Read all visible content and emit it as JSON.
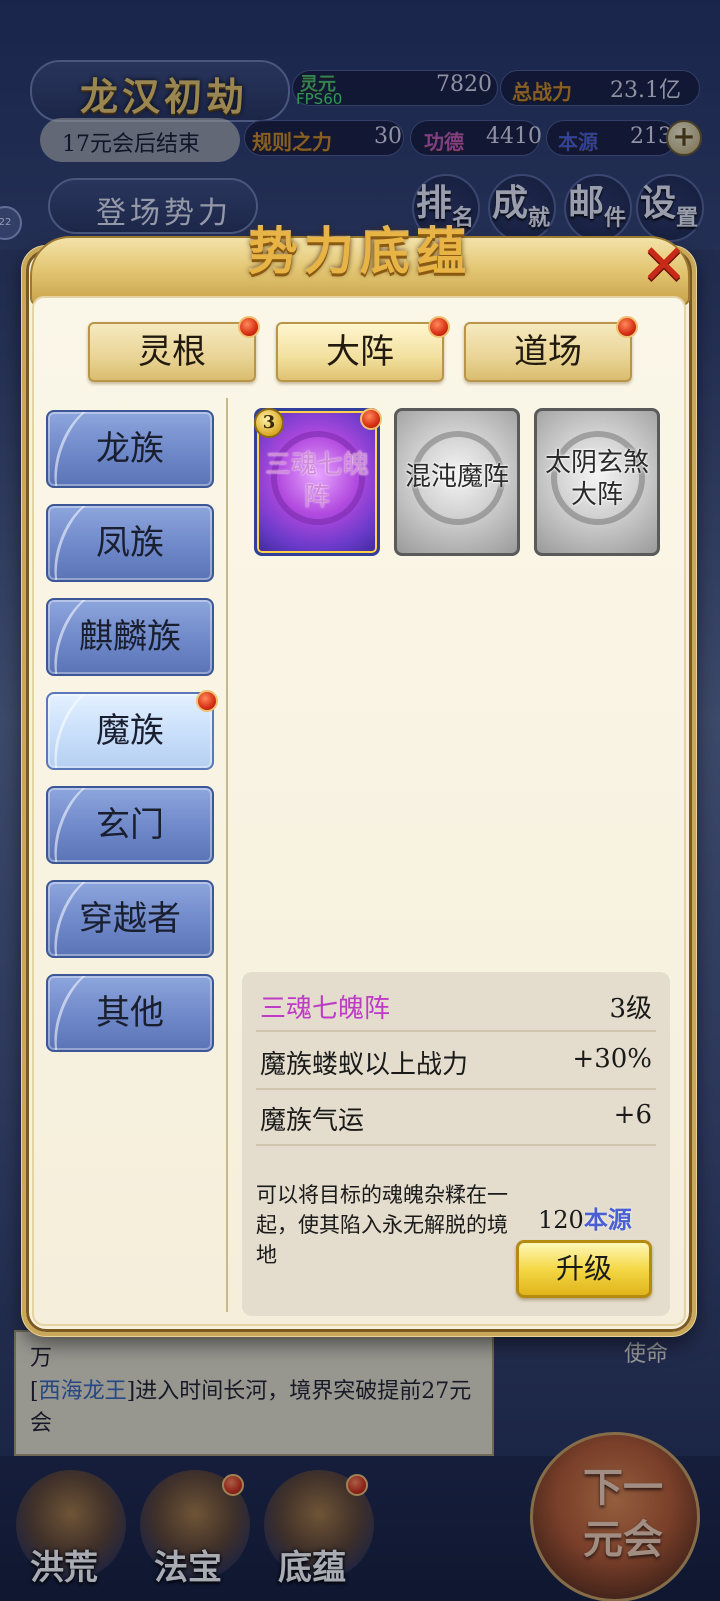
{
  "hud": {
    "title": "龙汉初劫",
    "fps": "FPS60",
    "end_notice": "17元会后结束",
    "faction": "登场势力",
    "stats": [
      {
        "label": "灵元",
        "value": "7820"
      },
      {
        "label": "总战力",
        "value": "23.1亿"
      },
      {
        "label": "规则之力",
        "value": "30"
      },
      {
        "label": "功德",
        "value": "4410"
      },
      {
        "label": "本源",
        "value": "213"
      }
    ],
    "nav": [
      {
        "big": "排",
        "small": "名"
      },
      {
        "big": "成",
        "small": "就"
      },
      {
        "big": "邮",
        "small": "件"
      },
      {
        "big": "设",
        "small": "置"
      }
    ],
    "side_badge": "22"
  },
  "panel": {
    "title": "势力底蕴",
    "tabs": [
      "灵根",
      "大阵",
      "道场"
    ],
    "races": [
      "龙族",
      "凤族",
      "麒麟族",
      "魔族",
      "玄门",
      "穿越者",
      "其他"
    ],
    "cards": [
      {
        "name": "三魂七魄阵",
        "level": "3"
      },
      {
        "name": "混沌魔阵"
      },
      {
        "name": "太阴玄煞大阵"
      }
    ],
    "detail": {
      "name": "三魂七魄阵",
      "level": "3级",
      "stat1_label": "魔族蝼蚁以上战力",
      "stat1_value": "+30%",
      "stat2_label": "魔族气运",
      "stat2_value": "+6",
      "description": "可以将目标的魂魄杂糅在一起，使其陷入永无解脱的境地",
      "cost_value": "120",
      "cost_unit": "本源",
      "upgrade_label": "升级"
    }
  },
  "log": {
    "fragment": "万",
    "bracket_open": "[",
    "name": "西海龙王",
    "bracket_close": "]",
    "text": "进入时间长河，境界突破提前27元会"
  },
  "bottom": {
    "nav": [
      "洪荒",
      "法宝",
      "底蕴"
    ],
    "next": "下一元会",
    "use": "使命"
  }
}
